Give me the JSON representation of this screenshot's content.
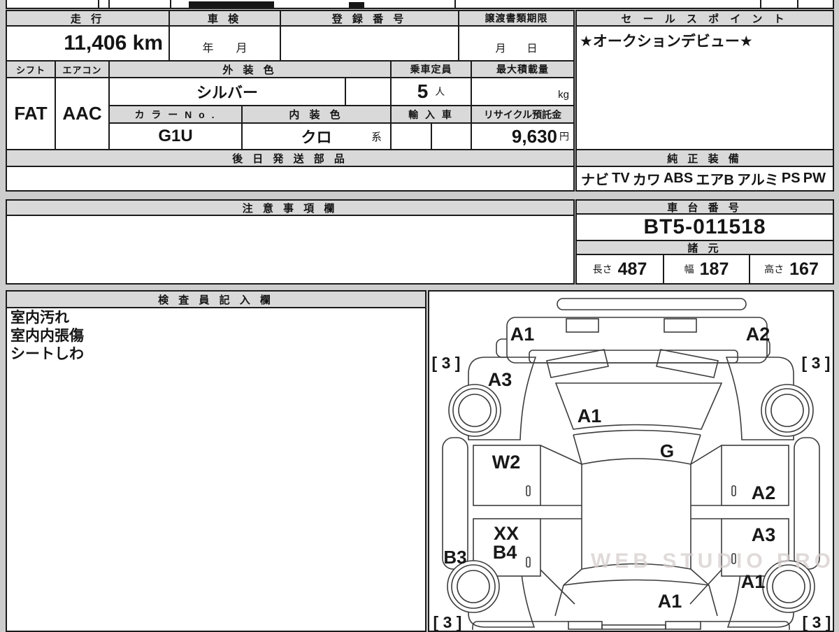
{
  "info": {
    "mileage": {
      "label": "走 行",
      "value": "11,406 km"
    },
    "shaken": {
      "label": "車 検",
      "value": "年　　月"
    },
    "registration": {
      "label": "登 録 番 号",
      "value": ""
    },
    "transfer": {
      "label": "譲渡書類期限",
      "value": "月　　日"
    },
    "shift": {
      "label": "シフト",
      "value": "FAT"
    },
    "aircon": {
      "label": "エアコン",
      "value": "AAC"
    },
    "exterior_color": {
      "label": "外 装 色",
      "value": "シルバー"
    },
    "capacity": {
      "label": "乗車定員",
      "value": "5",
      "unit": "人"
    },
    "max_load": {
      "label": "最大積載量",
      "value": "",
      "unit": "kg"
    },
    "color_no": {
      "label": "カ ラ ー N o .",
      "value": "G1U"
    },
    "interior_color": {
      "label": "内 装 色",
      "value": "クロ",
      "suffix": "系"
    },
    "import_car": {
      "label": "輸 入 車",
      "value": ""
    },
    "recycle_deposit": {
      "label": "リサイクル預託金",
      "value": "9,630",
      "unit": "円"
    },
    "later_parts": {
      "label": "後 日 発 送 部 品",
      "value": ""
    }
  },
  "sales_point": {
    "label": "セ ー ル ス ポ イ ン ト",
    "value": "★オークションデビュー★"
  },
  "equipment": {
    "label": "純 正 装 備",
    "items": [
      "ナビ",
      "TV",
      "カワ",
      "ABS",
      "エアB",
      "アルミ",
      "PS",
      "PW"
    ]
  },
  "notes": {
    "label": "注 意 事 項 欄",
    "value": ""
  },
  "chassis": {
    "label": "車 台 番 号",
    "value": "BT5-011518"
  },
  "specs": {
    "label": "諸 元",
    "dims": [
      {
        "label": "長さ",
        "value": "487"
      },
      {
        "label": "幅",
        "value": "187"
      },
      {
        "label": "高さ",
        "value": "167"
      }
    ]
  },
  "inspector": {
    "label": "検 査 員 記 入 欄",
    "lines": [
      "室内汚れ",
      "室内内張傷",
      "シートしわ"
    ]
  },
  "diagram": {
    "watermark": "WEB STUDIO PRO",
    "tire_mark": "[ 3 ]",
    "damage_labels": {
      "front_bumper_left": "A1",
      "front_bumper_right": "A2",
      "front_left_fender": "A3",
      "hood": "A1",
      "windshield": "G",
      "front_left_door": "W2",
      "rear_left_door_upper": "XX",
      "rear_left_door_lower": "B4",
      "left_sill": "B3",
      "front_right_door": "A2",
      "rear_right_door": "A3",
      "rear_right_fender": "A1",
      "trunk": "A1",
      "tire_fl": "[ 3 ]",
      "tire_fr": "[ 3 ]",
      "tire_rl": "[ 3 ]",
      "tire_rr": "[ 3 ]"
    }
  },
  "colors": {
    "header_bg": "#d9d9d9",
    "border": "#1b1b1b",
    "page_bg": "#cdcdcd"
  }
}
